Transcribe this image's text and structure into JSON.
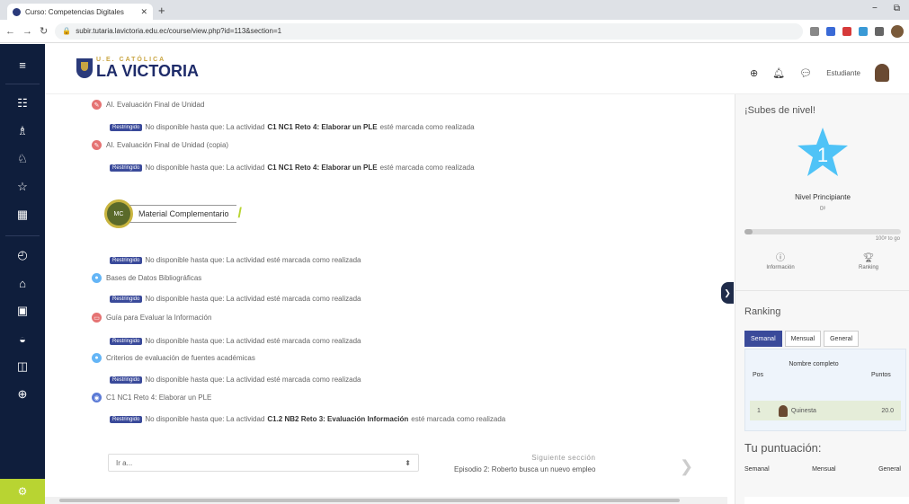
{
  "browser": {
    "tab_title": "Curso: Competencias Digitales",
    "url": "subir.tutaria.lavictoria.edu.ec/course/view.php?id=113&section=1",
    "window_controls": [
      "−",
      "⧉"
    ]
  },
  "header": {
    "logo_sub": "U.E. CATÓLICA",
    "logo_main": "LA VICTORIA",
    "user_name": "Estudiante"
  },
  "activities": [
    {
      "title": "AI. Evaluación Final de Unidad",
      "color": "#e57373",
      "icon": "quiz-icon"
    },
    {
      "title": "AI. Evaluación Final de Unidad (copia)",
      "color": "#e57373",
      "icon": "quiz-icon"
    },
    {
      "title": "Bases de Datos Bibliográficas",
      "color": "#64b5f6",
      "icon": "url-icon"
    },
    {
      "title": "Guía para Evaluar la Información",
      "color": "#e57373",
      "icon": "resource-icon"
    },
    {
      "title": "Criterios de evaluación de fuentes académicas",
      "color": "#64b5f6",
      "icon": "url-icon"
    },
    {
      "title": "C1 NC1 Reto 4: Elaborar un PLE",
      "color": "#5c7bd6",
      "icon": "assign-icon"
    }
  ],
  "restrictions": [
    {
      "badge": "Restringido",
      "pre": "No disponible hasta que: La actividad ",
      "bold": "C1 NC1 Reto 4: Elaborar un PLE",
      "post": " esté marcada como realizada"
    },
    {
      "badge": "Restringido",
      "pre": "No disponible hasta que: La actividad ",
      "bold": "C1 NC1 Reto 4: Elaborar un PLE",
      "post": " esté marcada como realizada"
    },
    {
      "badge": "Restringido",
      "pre": "No disponible hasta que: La actividad esté marcada como realizada",
      "bold": "",
      "post": ""
    },
    {
      "badge": "Restringido",
      "pre": "No disponible hasta que: La actividad esté marcada como realizada",
      "bold": "",
      "post": ""
    },
    {
      "badge": "Restringido",
      "pre": "No disponible hasta que: La actividad esté marcada como realizada",
      "bold": "",
      "post": ""
    },
    {
      "badge": "Restringido",
      "pre": "No disponible hasta que: La actividad esté marcada como realizada",
      "bold": "",
      "post": ""
    },
    {
      "badge": "Restringido",
      "pre": "No disponible hasta que: La actividad ",
      "bold": "C1.2 NB2 Reto 3: Evaluación Información",
      "post": " esté marcada como realizada"
    }
  ],
  "material_label": "Material Complementario",
  "material_circle": "MC",
  "nav": {
    "select_value": "Ir a...",
    "next_title": "Siguiente sección",
    "next_name": "Episodio 2: Roberto busca un nuevo empleo"
  },
  "sidebar": {
    "level_heading": "¡Subes de nivel!",
    "level_number": "1",
    "level_name": "Nivel Principiante",
    "level_points": "0ᵖ",
    "progress_label": "100ᵖ to go",
    "progress": 0.05,
    "btn_info": "Información",
    "btn_ranking": "Ranking",
    "ranking_heading": "Ranking",
    "tabs": [
      "Semanal",
      "Mensual",
      "General"
    ],
    "table_headers": {
      "pos": "Pos",
      "name": "Nombre completo",
      "points": "Puntos"
    },
    "row": {
      "pos": "1",
      "name": "Quinesta",
      "points": "20.0"
    },
    "score_heading": "Tu puntuación:",
    "score_cols": [
      "Semanal",
      "Mensual",
      "General"
    ]
  }
}
